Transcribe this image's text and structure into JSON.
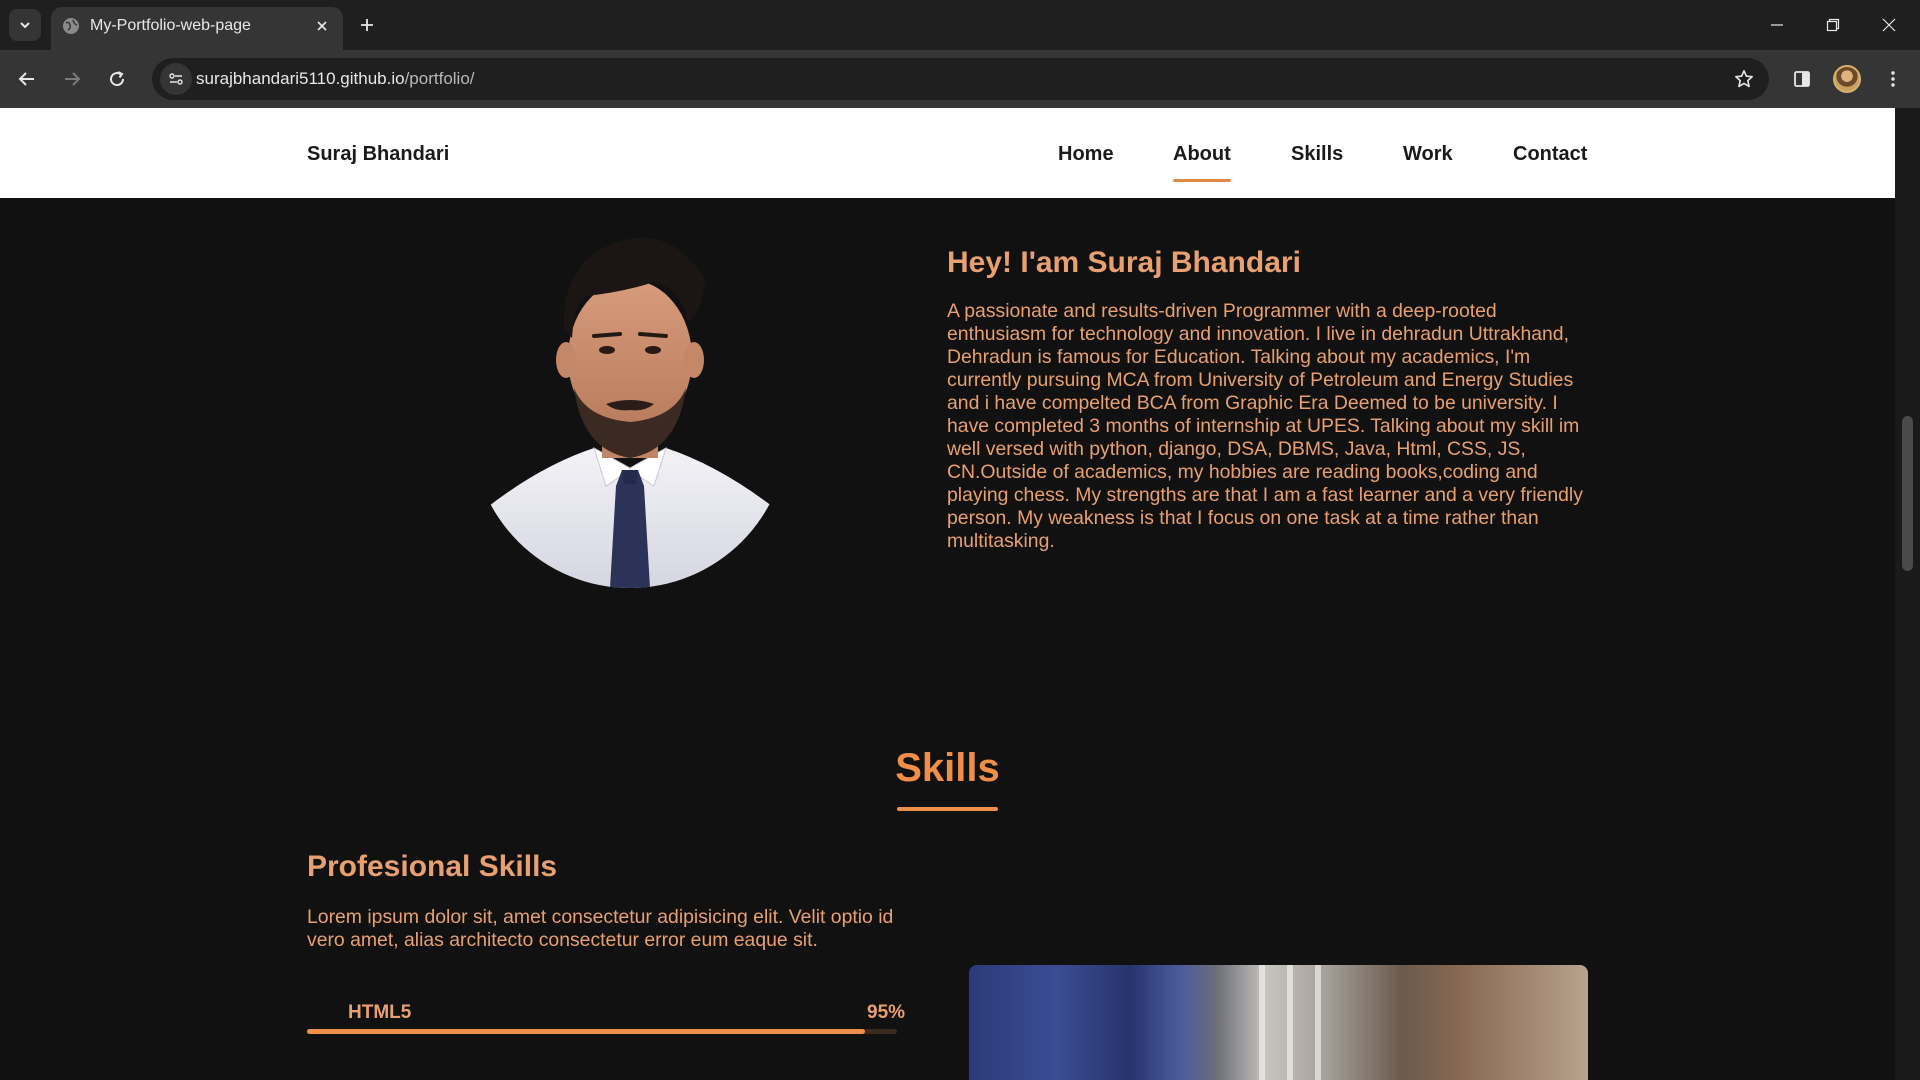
{
  "browser": {
    "tab_title": "My-Portfolio-web-page",
    "url_host": "surajbhandari5110.github.io",
    "url_path": "/portfolio/"
  },
  "navbar": {
    "brand": "Suraj Bhandari",
    "links": [
      {
        "label": "Home",
        "active": false
      },
      {
        "label": "About",
        "active": true
      },
      {
        "label": "Skills",
        "active": false
      },
      {
        "label": "Work",
        "active": false
      },
      {
        "label": "Contact",
        "active": false
      }
    ]
  },
  "about": {
    "title": "Hey! I'am Suraj Bhandari",
    "text": "A passionate and results-driven Programmer with a deep-rooted enthusiasm for technology and innovation. I live in dehradun Uttrakhand, Dehradun is famous for Education. Talking about my academics, I'm currently pursuing MCA from University of Petroleum and Energy Studies and i have compelted BCA from Graphic Era Deemed to be university. I have completed 3 months of internship at UPES. Talking about my skill im well versed with python, django, DSA, DBMS, Java, Html, CSS, JS, CN.Outside of academics, my hobbies are reading books,coding and playing chess. My strengths are that I am a fast learner and a very friendly person. My weakness is that I focus on one task at a time rather than multitasking."
  },
  "skills": {
    "heading": "Skills",
    "professional_title": "Profesional Skills",
    "professional_text": "Lorem ipsum dolor sit, amet consectetur adipisicing elit. Velit optio id vero amet, alias architecto consectetur error eum eaque sit.",
    "items": [
      {
        "name": "HTML5",
        "percent_label": "95%",
        "level": 0.95
      }
    ]
  },
  "colors": {
    "accent": "#ef8d4a",
    "text_accent": "#e8a071",
    "background": "#111111",
    "navbar_bg": "#ffffff"
  }
}
